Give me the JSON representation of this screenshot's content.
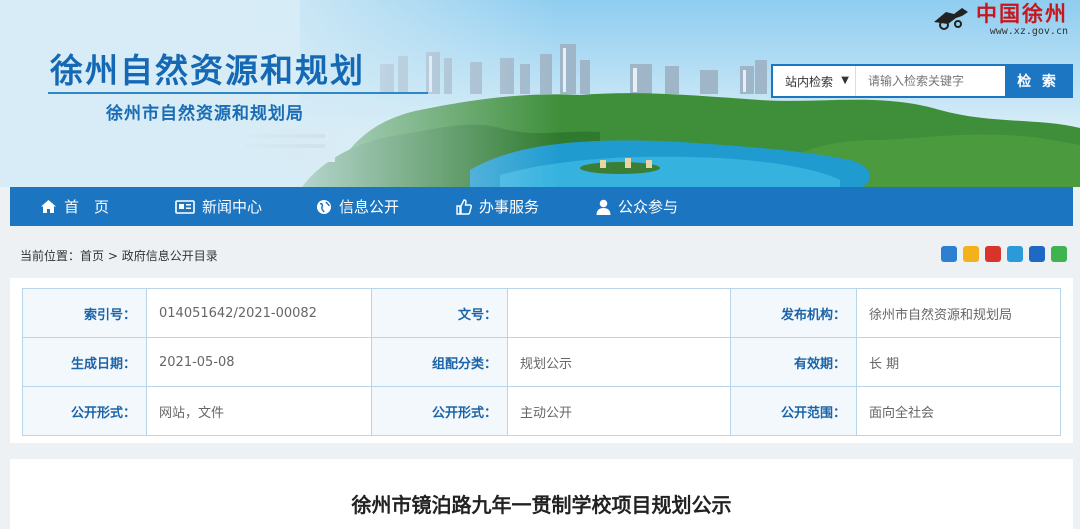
{
  "header": {
    "title": "徐州自然资源和规划",
    "subtitle": "徐州市自然资源和规划局",
    "logo_text": "中国徐州",
    "logo_url": "www.xz.gov.cn"
  },
  "search": {
    "scope": "站内检索",
    "placeholder": "请输入检索关键字",
    "button": "检 索"
  },
  "nav": [
    {
      "label": "首　页",
      "icon": "home-icon"
    },
    {
      "label": "新闻中心",
      "icon": "newspaper-icon"
    },
    {
      "label": "信息公开",
      "icon": "globe-icon"
    },
    {
      "label": "办事服务",
      "icon": "thumbs-up-icon"
    },
    {
      "label": "公众参与",
      "icon": "user-icon"
    }
  ],
  "breadcrumb": {
    "prefix": "当前位置：",
    "home": "首页",
    "sep": ">",
    "current": "政府信息公开目录"
  },
  "share_icons": [
    "share-plus-icon",
    "share-qzone-icon",
    "share-weibo-icon",
    "share-tencent-icon",
    "share-renren-icon",
    "share-wechat-icon"
  ],
  "share_colors": [
    "#2d7fd1",
    "#f3b11c",
    "#d9342b",
    "#2a9bd8",
    "#1f69c4",
    "#3fb34f"
  ],
  "meta": {
    "rows": [
      [
        {
          "label": "索引号：",
          "value": "014051642/2021-00082"
        },
        {
          "label": "文号：",
          "value": ""
        },
        {
          "label": "发布机构：",
          "value": "徐州市自然资源和规划局"
        }
      ],
      [
        {
          "label": "生成日期：",
          "value": "2021-05-08"
        },
        {
          "label": "组配分类：",
          "value": "规划公示"
        },
        {
          "label": "有效期：",
          "value": "长 期"
        }
      ],
      [
        {
          "label": "公开形式：",
          "value": "网站，文件"
        },
        {
          "label": "公开形式：",
          "value": "主动公开"
        },
        {
          "label": "公开范围：",
          "value": "面向全社会"
        }
      ]
    ]
  },
  "article": {
    "title": "徐州市镜泊路九年一贯制学校项目规划公示"
  },
  "colors": {
    "nav_bg": "#1c75c0",
    "title_blue": "#1569b4",
    "label_blue": "#1c64a8",
    "logo_red": "#c8161d"
  }
}
